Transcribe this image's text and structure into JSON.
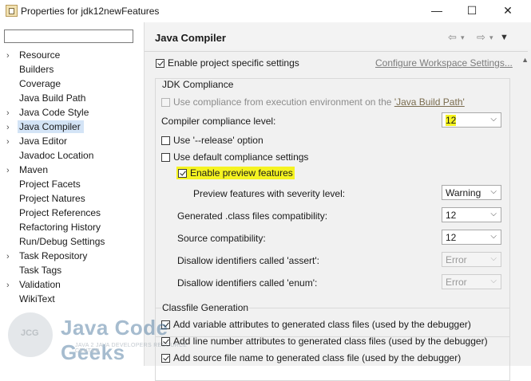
{
  "window": {
    "title": "Properties for jdk12newFeatures",
    "minimize": "—",
    "maximize": "☐",
    "close": "✕"
  },
  "sidebar": {
    "filter_value": "",
    "items": [
      {
        "label": "Resource",
        "expandable": true
      },
      {
        "label": "Builders",
        "expandable": false
      },
      {
        "label": "Coverage",
        "expandable": false
      },
      {
        "label": "Java Build Path",
        "expandable": false
      },
      {
        "label": "Java Code Style",
        "expandable": true
      },
      {
        "label": "Java Compiler",
        "expandable": true,
        "selected": true
      },
      {
        "label": "Java Editor",
        "expandable": true
      },
      {
        "label": "Javadoc Location",
        "expandable": false
      },
      {
        "label": "Maven",
        "expandable": true
      },
      {
        "label": "Project Facets",
        "expandable": false
      },
      {
        "label": "Project Natures",
        "expandable": false
      },
      {
        "label": "Project References",
        "expandable": false
      },
      {
        "label": "Refactoring History",
        "expandable": false
      },
      {
        "label": "Run/Debug Settings",
        "expandable": false
      },
      {
        "label": "Task Repository",
        "expandable": true
      },
      {
        "label": "Task Tags",
        "expandable": false
      },
      {
        "label": "Validation",
        "expandable": true
      },
      {
        "label": "WikiText",
        "expandable": false
      }
    ]
  },
  "main": {
    "title": "Java Compiler",
    "enable_project_settings": "Enable project specific settings",
    "configure_workspace": "Configure Workspace Settings...",
    "jdk_group": "JDK Compliance",
    "use_compliance_prefix": "Use compliance from execution environment on the ",
    "use_compliance_link": "'Java Build Path'",
    "compliance_level_label": "Compiler compliance level:",
    "compliance_level_value": "12",
    "use_release": "Use '--release' option",
    "use_default_compliance": "Use default compliance settings",
    "enable_preview": "Enable preview features",
    "preview_severity_label": "Preview features with severity level:",
    "preview_severity_value": "Warning",
    "generated_compat_label": "Generated .class files compatibility:",
    "generated_compat_value": "12",
    "source_compat_label": "Source compatibility:",
    "source_compat_value": "12",
    "disallow_assert_label": "Disallow identifiers called 'assert':",
    "disallow_assert_value": "Error",
    "disallow_enum_label": "Disallow identifiers called 'enum':",
    "disallow_enum_value": "Error",
    "classfile_group": "Classfile Generation",
    "add_variable": "Add variable attributes to generated class files (used by the debugger)",
    "add_line": "Add line number attributes to generated class files (used by the debugger)",
    "add_source": "Add source file name to generated class file (used by the debugger)"
  },
  "watermark": {
    "badge": "JCG",
    "brand": "Java Code Geeks",
    "tagline": "JAVA 2 JAVA DEVELOPERS RESOURCE CENTER"
  },
  "colors": {
    "highlight": "#f5f321",
    "selection": "#d4e4f6"
  }
}
